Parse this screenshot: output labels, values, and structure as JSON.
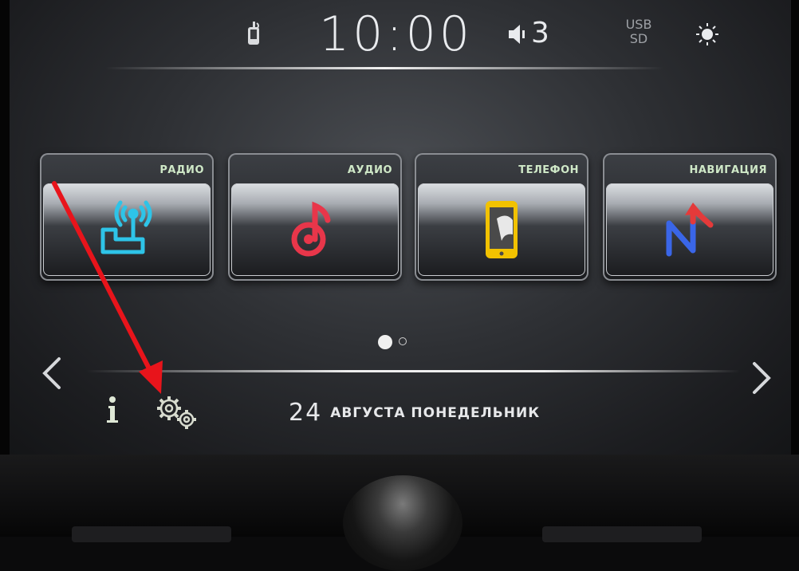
{
  "status_bar": {
    "time": "10:00",
    "volume_level": "3",
    "media_source_line1": "USB",
    "media_source_line2": "SD",
    "phone_icon": "phone-signal-icon",
    "volume_icon": "speaker-icon",
    "brightness_icon": "brightness-icon"
  },
  "tiles": [
    {
      "label": "РАДИО",
      "icon": "radio-antenna-icon",
      "icon_color": "#2ec4e8"
    },
    {
      "label": "АУДИО",
      "icon": "music-note-icon",
      "icon_color": "#e8364a"
    },
    {
      "label": "ТЕЛЕФОН",
      "icon": "smartphone-icon",
      "icon_color": "#f2c200"
    },
    {
      "label": "НАВИГАЦИЯ",
      "icon": "navigation-route-icon",
      "icon_color": "#e43a3a"
    }
  ],
  "pagination": {
    "pages": 2,
    "current": 1
  },
  "bottom_bar": {
    "info_icon": "info-icon",
    "settings_icon": "settings-gears-icon",
    "date_day": "24",
    "date_text": "АВГУСТА ПОНЕДЕЛЬНИК"
  },
  "colors": {
    "annotation_arrow": "#e8141b",
    "tab_label": "#cfe8c7",
    "text": "#e9ebee"
  }
}
